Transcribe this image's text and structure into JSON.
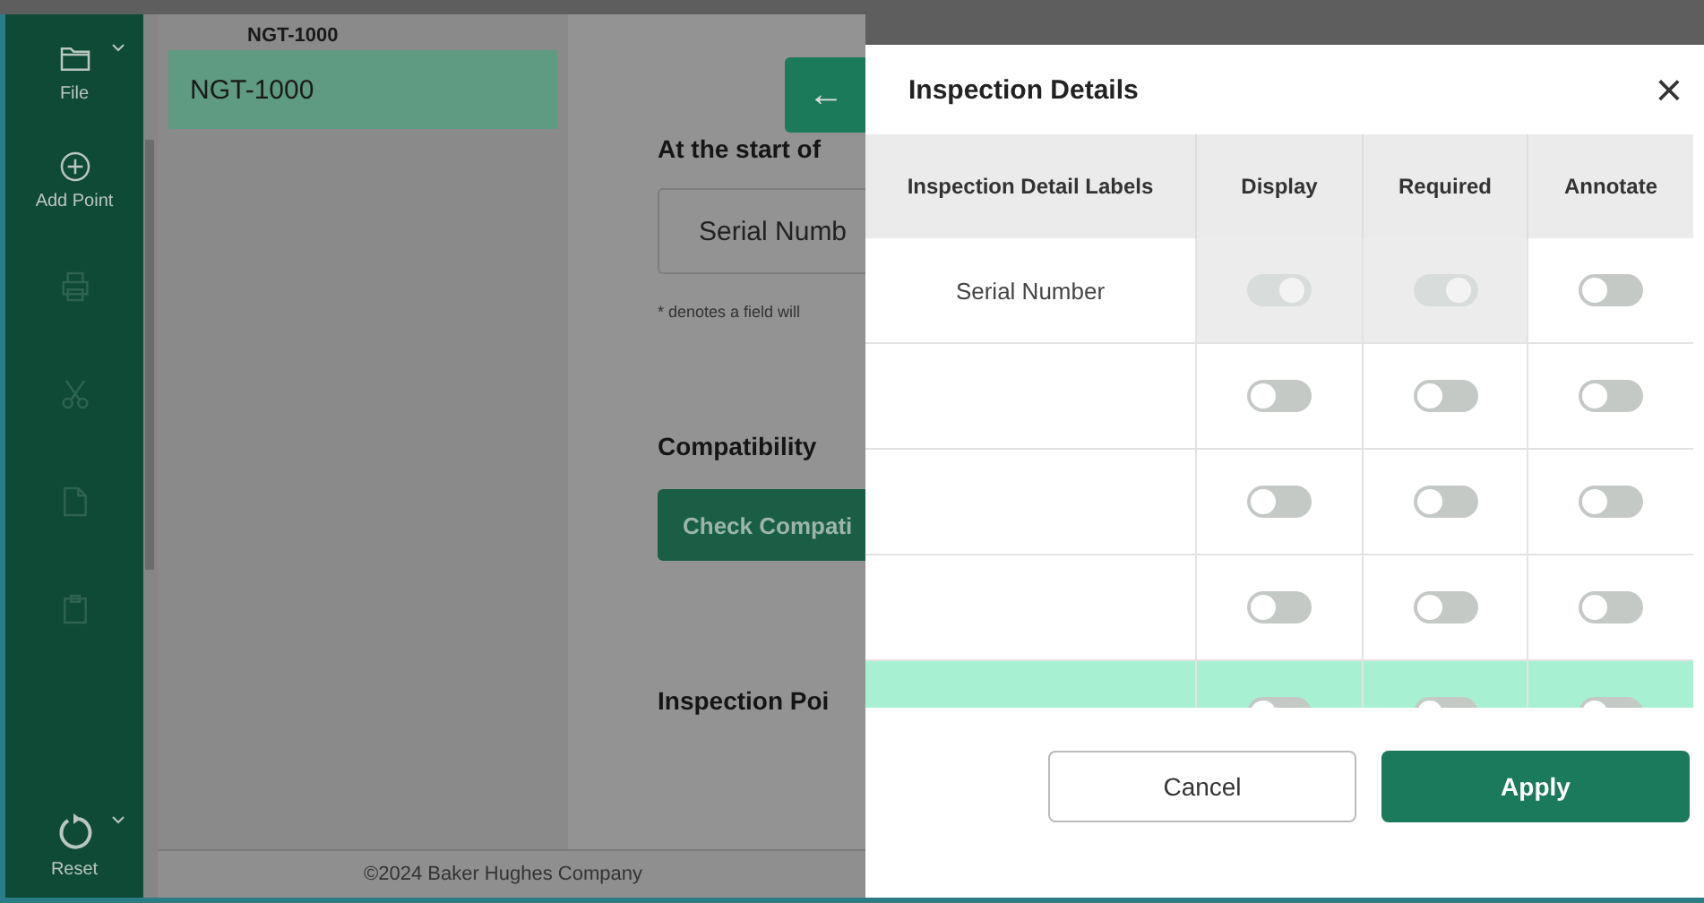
{
  "toolbar": [
    {
      "kind": "folder",
      "label": "File",
      "disabled": false,
      "has_menu": true
    },
    {
      "kind": "add",
      "label": "Add Point",
      "disabled": false,
      "has_menu": false
    },
    {
      "kind": "print",
      "disabled": true,
      "has_menu": false
    },
    {
      "kind": "cut",
      "disabled": true,
      "has_menu": false
    },
    {
      "kind": "copy",
      "disabled": true,
      "has_menu": false
    },
    {
      "kind": "paste",
      "disabled": true,
      "has_menu": false
    },
    {
      "kind": "reset",
      "label": "Reset",
      "disabled": false,
      "has_menu": true
    }
  ],
  "tree": {
    "title": "NGT-1000",
    "items": [
      {
        "label": "NGT-1000",
        "selected": true
      }
    ]
  },
  "content": {
    "back_button": "←",
    "start_heading": "At the start of",
    "field_value": "Serial Numb",
    "note": "* denotes a field will",
    "compat_heading": "Compatibility",
    "compat_button": "Check Compati",
    "points_heading": "Inspection Poi"
  },
  "footer": "©2024 Baker Hughes Company",
  "dialog": {
    "title": "Inspection Details",
    "close": "×",
    "columns": [
      "Inspection Detail Labels",
      "Display",
      "Required",
      "Annotate"
    ],
    "rows": [
      {
        "label": "Serial Number",
        "selected": false,
        "toggles": [
          {
            "on": true,
            "disabled": true
          },
          {
            "on": true,
            "disabled": true
          },
          {
            "on": false,
            "disabled": false
          }
        ]
      },
      {
        "selected": false,
        "toggles": [
          {
            "on": false,
            "disabled": false
          },
          {
            "on": false,
            "disabled": false
          },
          {
            "on": false,
            "disabled": false
          }
        ]
      },
      {
        "selected": false,
        "toggles": [
          {
            "on": false,
            "disabled": false
          },
          {
            "on": false,
            "disabled": false
          },
          {
            "on": false,
            "disabled": false
          }
        ]
      },
      {
        "selected": false,
        "toggles": [
          {
            "on": false,
            "disabled": false
          },
          {
            "on": false,
            "disabled": false
          },
          {
            "on": false,
            "disabled": false
          }
        ]
      },
      {
        "selected": true,
        "toggles": [
          {
            "on": false,
            "disabled": false
          },
          {
            "on": false,
            "disabled": false
          },
          {
            "on": false,
            "disabled": false
          }
        ]
      }
    ],
    "buttons": [
      {
        "label": "Cancel",
        "kind": "secondary"
      },
      {
        "label": "Apply",
        "kind": "primary"
      }
    ]
  }
}
